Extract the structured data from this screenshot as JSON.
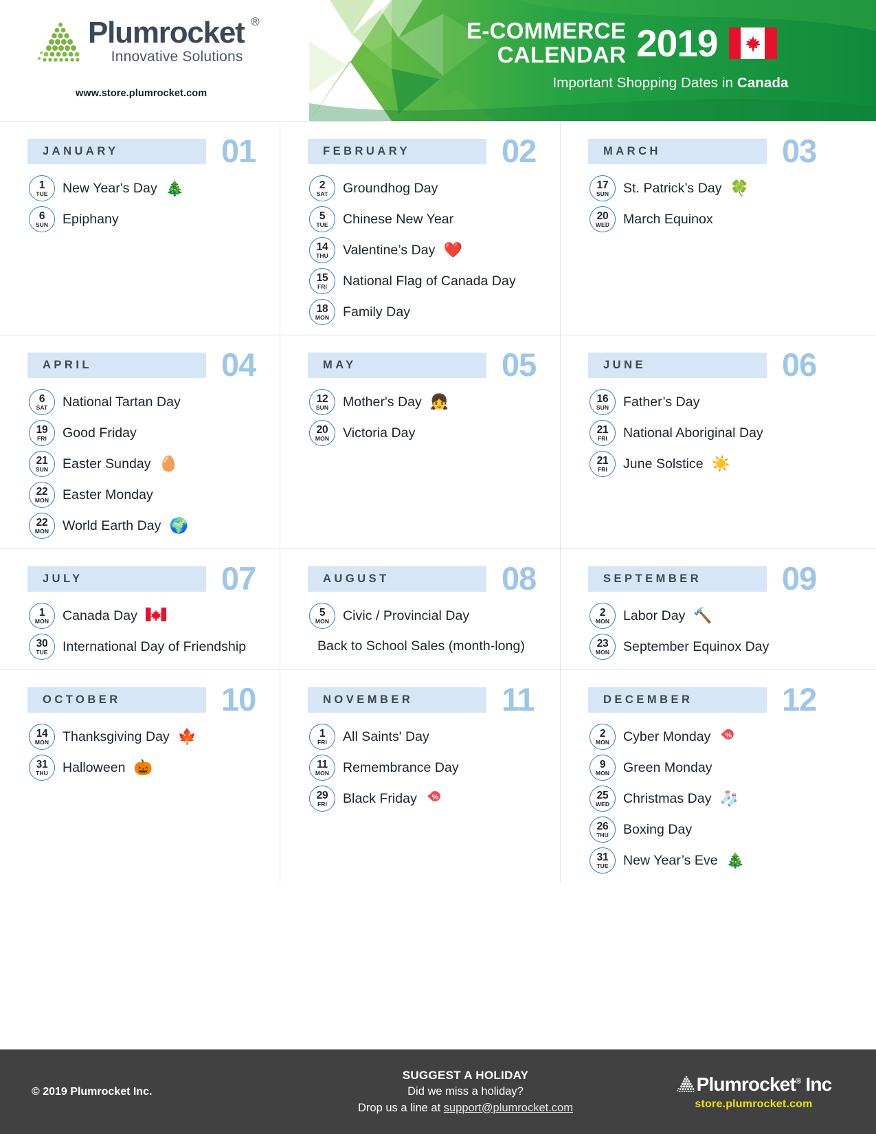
{
  "header": {
    "brand_name": "Plumrocket",
    "brand_reg": "®",
    "brand_tagline": "Innovative Solutions",
    "brand_url": "www.store.plumrocket.com",
    "title_line1": "E-COMMERCE",
    "title_line2": "CALENDAR",
    "year": "2019",
    "subtitle_prefix": "Important Shopping Dates in ",
    "subtitle_country": "Canada",
    "flag_icon": "canada-flag-icon",
    "accent_green": "#2aa03c",
    "accent_blue": "#9dc6e9",
    "header_band_blue": "#d6e6f7"
  },
  "months": [
    {
      "name": "JANUARY",
      "number": "01",
      "events": [
        {
          "day": "1",
          "dow": "TUE",
          "label": "New Year's Day",
          "emoji": "🎄",
          "emoji_name": "christmas-tree-icon"
        },
        {
          "day": "6",
          "dow": "SUN",
          "label": "Epiphany",
          "emoji": "",
          "emoji_name": ""
        }
      ]
    },
    {
      "name": "FEBRUARY",
      "number": "02",
      "events": [
        {
          "day": "2",
          "dow": "SAT",
          "label": "Groundhog Day",
          "emoji": "",
          "emoji_name": ""
        },
        {
          "day": "5",
          "dow": "TUE",
          "label": "Chinese New Year",
          "emoji": "",
          "emoji_name": ""
        },
        {
          "day": "14",
          "dow": "THU",
          "label": "Valentine’s Day",
          "emoji": "❤️",
          "emoji_name": "heart-icon"
        },
        {
          "day": "15",
          "dow": "FRI",
          "label": "National Flag of Canada Day",
          "emoji": "",
          "emoji_name": ""
        },
        {
          "day": "18",
          "dow": "MON",
          "label": "Family Day",
          "emoji": "",
          "emoji_name": ""
        }
      ]
    },
    {
      "name": "MARCH",
      "number": "03",
      "events": [
        {
          "day": "17",
          "dow": "SUN",
          "label": "St. Patrick’s Day",
          "emoji": "🍀",
          "emoji_name": "four-leaf-clover-icon"
        },
        {
          "day": "20",
          "dow": "WED",
          "label": "March Equinox",
          "emoji": "",
          "emoji_name": ""
        }
      ]
    },
    {
      "name": "APRIL",
      "number": "04",
      "events": [
        {
          "day": "6",
          "dow": "SAT",
          "label": "National Tartan Day",
          "emoji": "",
          "emoji_name": ""
        },
        {
          "day": "19",
          "dow": "FRI",
          "label": "Good Friday",
          "emoji": "",
          "emoji_name": ""
        },
        {
          "day": "21",
          "dow": "SUN",
          "label": "Easter Sunday",
          "emoji": "🥚",
          "emoji_name": "easter-egg-icon"
        },
        {
          "day": "22",
          "dow": "MON",
          "label": "Easter Monday",
          "emoji": "",
          "emoji_name": ""
        },
        {
          "day": "22",
          "dow": "MON",
          "label": "World Earth Day",
          "emoji": "🌍",
          "emoji_name": "globe-icon"
        }
      ]
    },
    {
      "name": "MAY",
      "number": "05",
      "events": [
        {
          "day": "12",
          "dow": "SUN",
          "label": "Mother's Day",
          "emoji": "👧",
          "emoji_name": "girl-face-icon"
        },
        {
          "day": "20",
          "dow": "MON",
          "label": "Victoria Day",
          "emoji": "",
          "emoji_name": ""
        }
      ]
    },
    {
      "name": "JUNE",
      "number": "06",
      "events": [
        {
          "day": "16",
          "dow": "SUN",
          "label": "Father’s Day",
          "emoji": "",
          "emoji_name": ""
        },
        {
          "day": "21",
          "dow": "FRI",
          "label": "National Aboriginal Day",
          "emoji": "",
          "emoji_name": ""
        },
        {
          "day": "21",
          "dow": "FRI",
          "label": "June Solstice",
          "emoji": "☀️",
          "emoji_name": "sun-icon"
        }
      ]
    },
    {
      "name": "JULY",
      "number": "07",
      "events": [
        {
          "day": "1",
          "dow": "MON",
          "label": "Canada Day",
          "emoji": "🇨🇦",
          "emoji_name": "canada-flag-icon"
        },
        {
          "day": "30",
          "dow": "TUE",
          "label": "International Day of Friendship",
          "emoji": "",
          "emoji_name": ""
        }
      ]
    },
    {
      "name": "AUGUST",
      "number": "08",
      "events": [
        {
          "day": "5",
          "dow": "MON",
          "label": "Civic / Provincial Day",
          "emoji": "",
          "emoji_name": ""
        },
        {
          "day": "",
          "dow": "",
          "label": "Back to School Sales  (month-long)",
          "emoji": "",
          "emoji_name": ""
        }
      ]
    },
    {
      "name": "SEPTEMBER",
      "number": "09",
      "events": [
        {
          "day": "2",
          "dow": "MON",
          "label": "Labor Day",
          "emoji": "🔨",
          "emoji_name": "hammer-icon"
        },
        {
          "day": "23",
          "dow": "MON",
          "label": "September Equinox Day",
          "emoji": "",
          "emoji_name": ""
        }
      ]
    },
    {
      "name": "OCTOBER",
      "number": "10",
      "events": [
        {
          "day": "14",
          "dow": "MON",
          "label": "Thanksgiving Day",
          "emoji": "🍁",
          "emoji_name": "maple-leaf-icon"
        },
        {
          "day": "31",
          "dow": "THU",
          "label": "Halloween",
          "emoji": "🎃",
          "emoji_name": "jack-o-lantern-icon"
        }
      ]
    },
    {
      "name": "NOVEMBER",
      "number": "11",
      "events": [
        {
          "day": "1",
          "dow": "FRI",
          "label": "All Saints' Day",
          "emoji": "",
          "emoji_name": ""
        },
        {
          "day": "11",
          "dow": "MON",
          "label": "Remembrance Day",
          "emoji": "",
          "emoji_name": ""
        },
        {
          "day": "29",
          "dow": "FRI",
          "label": "Black Friday",
          "emoji": "%",
          "emoji_name": "discount-percent-icon"
        }
      ]
    },
    {
      "name": "DECEMBER",
      "number": "12",
      "events": [
        {
          "day": "2",
          "dow": "MON",
          "label": "Cyber Monday",
          "emoji": "%",
          "emoji_name": "discount-percent-icon"
        },
        {
          "day": "9",
          "dow": "MON",
          "label": "Green Monday",
          "emoji": "",
          "emoji_name": ""
        },
        {
          "day": "25",
          "dow": "WED",
          "label": "Christmas Day",
          "emoji": "🧦",
          "emoji_name": "christmas-stocking-icon"
        },
        {
          "day": "26",
          "dow": "THU",
          "label": "Boxing Day",
          "emoji": "",
          "emoji_name": ""
        },
        {
          "day": "31",
          "dow": "TUE",
          "label": "New Year’s Eve",
          "emoji": "🎄",
          "emoji_name": "christmas-tree-icon"
        }
      ]
    }
  ],
  "footer": {
    "copyright": "© 2019 Plumrocket Inc.",
    "suggest_title": "SUGGEST A HOLIDAY",
    "suggest_line2": "Did we miss a holiday?",
    "suggest_line3_prefix": "Drop us a line at ",
    "suggest_email": "support@plumrocket.com",
    "brand_name": "Plumrocket",
    "brand_reg": "®",
    "brand_suffix": " Inc",
    "site": "store.plumrocket.com",
    "site_color": "#f2e205",
    "background": "#414141"
  }
}
